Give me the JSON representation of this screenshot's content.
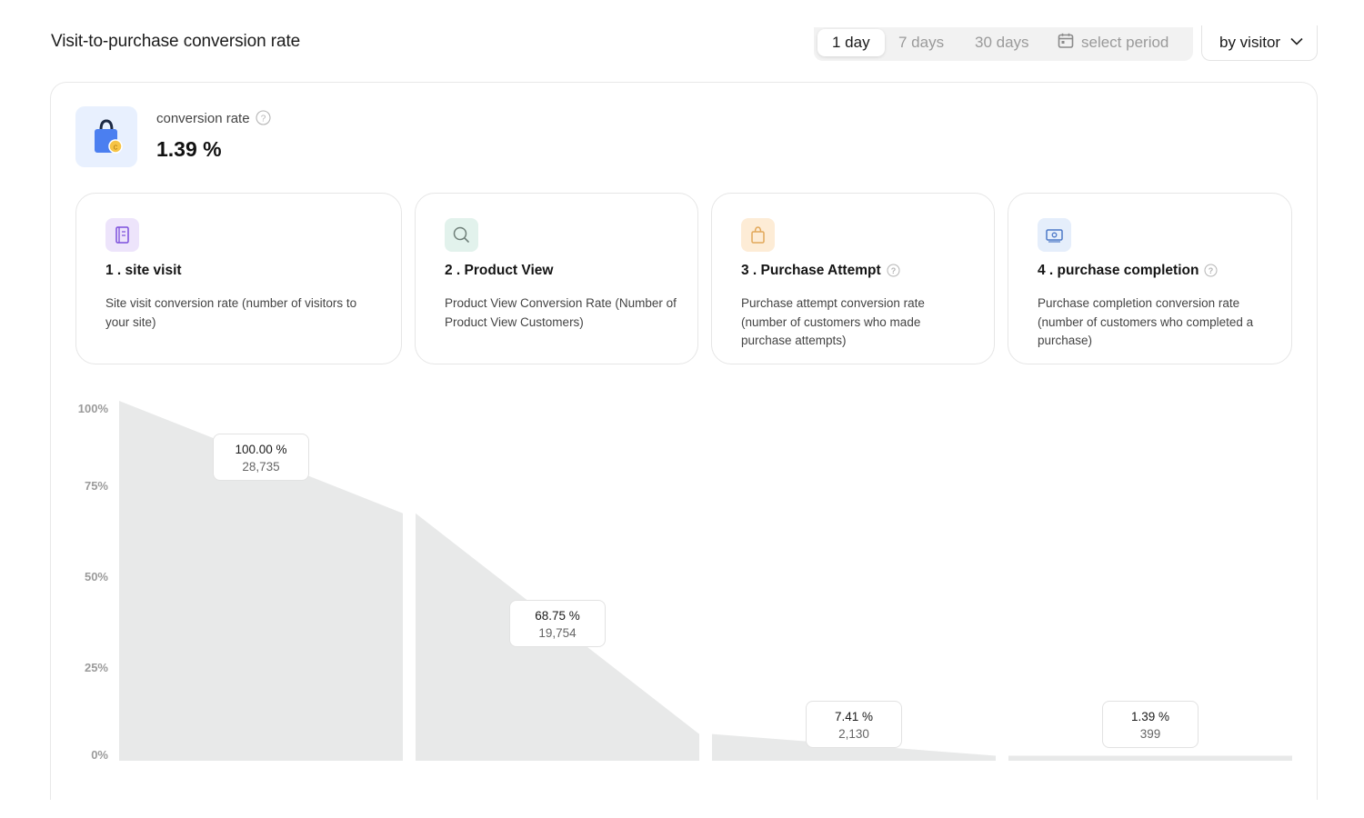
{
  "header": {
    "title": "Visit-to-purchase conversion rate",
    "periods": [
      "1 day",
      "7 days",
      "30 days"
    ],
    "active_period": "1 day",
    "select_period_label": "select period",
    "visitor_select_label": "by visitor"
  },
  "kpi": {
    "label": "conversion rate",
    "value": "1.39 %"
  },
  "stages": [
    {
      "title": "1 . site visit",
      "description": "Site visit conversion rate (number of visitors to your site)",
      "has_help": false,
      "icon": "document-icon",
      "color": "#ede4fb"
    },
    {
      "title": "2 . Product View",
      "description": "Product View Conversion Rate (Number of Product View Customers)",
      "has_help": false,
      "icon": "search-icon",
      "color": "#e2f2ec"
    },
    {
      "title": "3 . Purchase Attempt",
      "description": "Purchase attempt conversion rate (number of customers who made purchase attempts)",
      "has_help": true,
      "icon": "shopping-bag-icon",
      "color": "#fdecd6"
    },
    {
      "title": "4 . purchase completion",
      "description": "Purchase completion conversion rate (number of customers who completed a purchase)",
      "has_help": true,
      "icon": "cash-icon",
      "color": "#e5eefb"
    }
  ],
  "chart_data": {
    "type": "area",
    "categories": [
      "1 . site visit",
      "2 . Product View",
      "3 . Purchase Attempt",
      "4 . purchase completion"
    ],
    "y_ticks": [
      "100%",
      "75%",
      "50%",
      "25%",
      "0%"
    ],
    "ylim": [
      0,
      100
    ],
    "values": [
      100.0,
      68.75,
      7.41,
      1.39
    ],
    "value_labels": [
      "100.00 %",
      "68.75 %",
      "7.41 %",
      "1.39 %"
    ],
    "counts": [
      "28,735",
      "19,754",
      "2,130",
      "399"
    ],
    "fill_color": "#e8e9e9",
    "grid": false
  }
}
